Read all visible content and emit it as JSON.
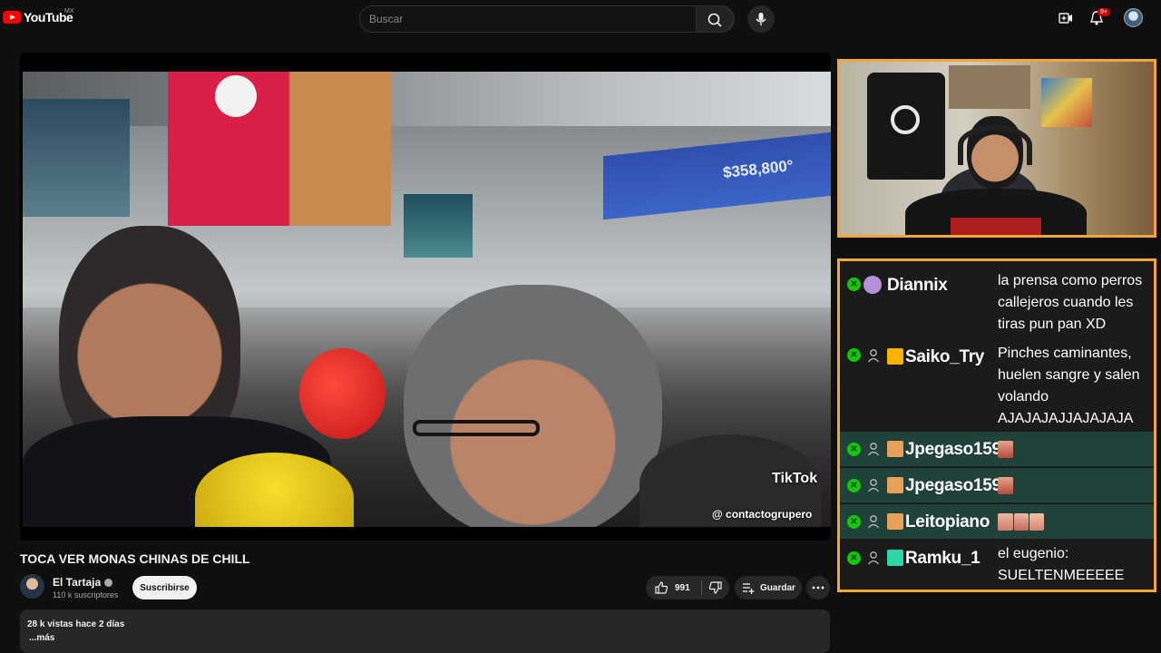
{
  "header": {
    "logo_text": "YouTube",
    "country": "MX",
    "search_placeholder": "Buscar",
    "notifications_badge": "9+"
  },
  "video": {
    "title": "TOCA VER MONAS CHINAS DE CHILL",
    "overlay_price": "$358,800°",
    "tiktok_label": "TikTok",
    "tiktok_handle": "@ contactogrupero"
  },
  "channel": {
    "name": "El Tartaja",
    "subscribers": "110 k suscriptores",
    "subscribe_label": "Suscribirse"
  },
  "actions": {
    "likes": "991",
    "save_label": "Guardar"
  },
  "description": {
    "stats": "28 k vistas  hace 2 días",
    "more": "...más"
  },
  "chat": {
    "messages": [
      {
        "user": "Diannix",
        "text": "la prensa como perros callejeros cuando les tiras pun pan XD",
        "highlight": false
      },
      {
        "user": "Saiko_Try",
        "text": "Pinches caminantes, huelen sangre y salen volando AJAJAJAJJAJAJAJA",
        "highlight": false
      },
      {
        "user": "Jpegaso159",
        "text": "",
        "highlight": true
      },
      {
        "user": "Jpegaso159",
        "text": "",
        "highlight": true
      },
      {
        "user": "Leitopiano",
        "text": "",
        "highlight": true
      },
      {
        "user": "Ramku_1",
        "text": "el eugenio: SUELTENMEEEEE",
        "highlight": false
      }
    ]
  },
  "colors": {
    "accent_border": "#f4a53a",
    "chat_badge": "#16c60c",
    "youtube_red": "#ff0000"
  }
}
